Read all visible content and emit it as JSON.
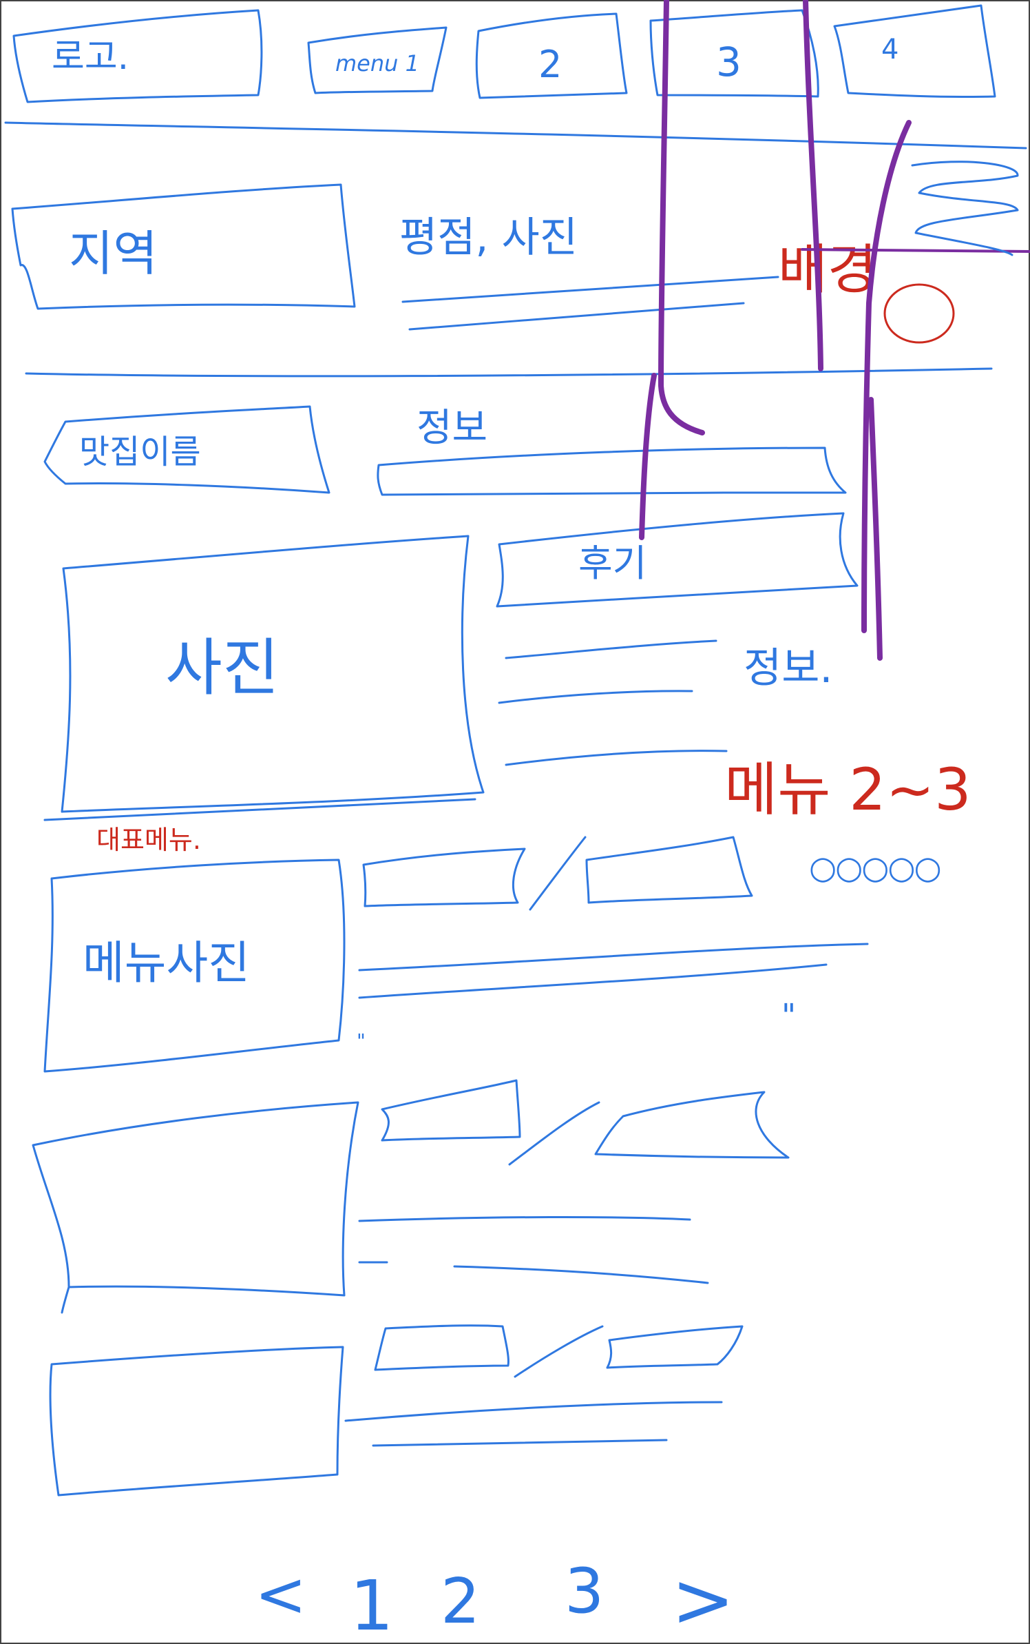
{
  "header": {
    "logo": "로고.",
    "menu": [
      "menu 1",
      "2",
      "3",
      "4"
    ]
  },
  "hero": {
    "region_label": "지역",
    "rating_photo_label": "평점, 사진",
    "note_label": "배경"
  },
  "store": {
    "name_label": "맛집이름",
    "info_label": "정보",
    "photo_label": "사진",
    "review_label": "후기",
    "detail_label": "정보.",
    "menu_pages_label": "메뉴 2~3",
    "dots": "○○○○○"
  },
  "menu_section": {
    "rep_menu_label": "대표메뉴.",
    "menu_photo_label": "메뉴사진",
    "ditto": "\"",
    "small_note": "\""
  },
  "pagination": {
    "prev": "<",
    "pages": [
      "1",
      "2",
      "3"
    ],
    "next": ">"
  },
  "colors": {
    "sketch_blue": "#2f78e0",
    "highlight_purple": "#7a2da0",
    "note_red": "#cc2a1e",
    "background": "#ffffff"
  }
}
